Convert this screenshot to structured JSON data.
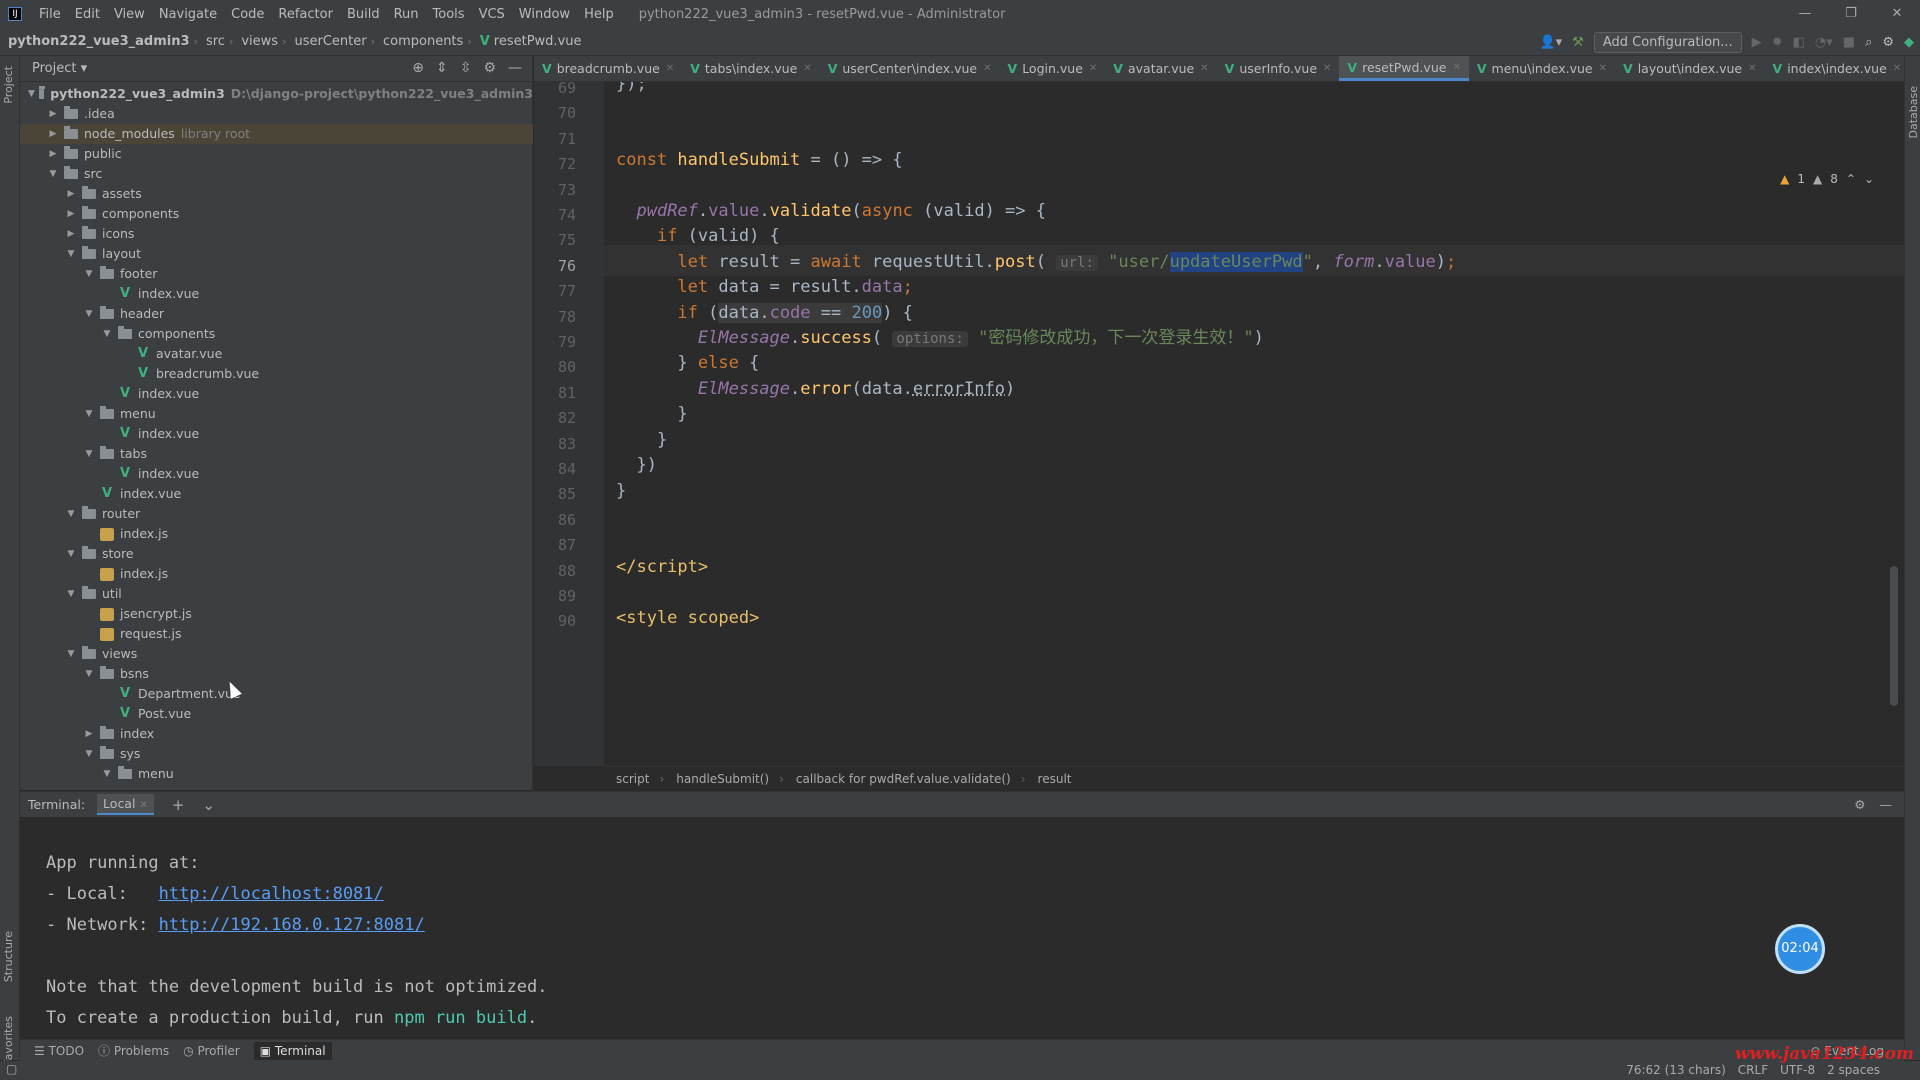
{
  "titlebar": {
    "menus": [
      "File",
      "Edit",
      "View",
      "Navigate",
      "Code",
      "Refactor",
      "Build",
      "Run",
      "Tools",
      "VCS",
      "Window",
      "Help"
    ],
    "title": "python222_vue3_admin3 - resetPwd.vue - Administrator"
  },
  "navbar": {
    "crumbs": [
      "python222_vue3_admin3",
      "src",
      "views",
      "userCenter",
      "components",
      "resetPwd.vue"
    ],
    "add_config": "Add Configuration..."
  },
  "project": {
    "label": "Project",
    "tree": [
      {
        "indent": 0,
        "type": "root",
        "open": true,
        "name": "python222_vue3_admin3",
        "hint": "D:\\django-project\\python222_vue3_admin3"
      },
      {
        "indent": 1,
        "type": "folder",
        "open": false,
        "name": ".idea"
      },
      {
        "indent": 1,
        "type": "folder",
        "open": false,
        "name": "node_modules",
        "hint": "library root",
        "selected": true
      },
      {
        "indent": 1,
        "type": "folder",
        "open": false,
        "name": "public"
      },
      {
        "indent": 1,
        "type": "folder",
        "open": true,
        "name": "src"
      },
      {
        "indent": 2,
        "type": "folder",
        "open": false,
        "name": "assets"
      },
      {
        "indent": 2,
        "type": "folder",
        "open": false,
        "name": "components"
      },
      {
        "indent": 2,
        "type": "folder",
        "open": false,
        "name": "icons"
      },
      {
        "indent": 2,
        "type": "folder",
        "open": true,
        "name": "layout"
      },
      {
        "indent": 3,
        "type": "folder",
        "open": true,
        "name": "footer"
      },
      {
        "indent": 4,
        "type": "vue",
        "name": "index.vue"
      },
      {
        "indent": 3,
        "type": "folder",
        "open": true,
        "name": "header"
      },
      {
        "indent": 4,
        "type": "folder",
        "open": true,
        "name": "components"
      },
      {
        "indent": 5,
        "type": "vue",
        "name": "avatar.vue"
      },
      {
        "indent": 5,
        "type": "vue",
        "name": "breadcrumb.vue"
      },
      {
        "indent": 4,
        "type": "vue",
        "name": "index.vue"
      },
      {
        "indent": 3,
        "type": "folder",
        "open": true,
        "name": "menu"
      },
      {
        "indent": 4,
        "type": "vue",
        "name": "index.vue"
      },
      {
        "indent": 3,
        "type": "folder",
        "open": true,
        "name": "tabs"
      },
      {
        "indent": 4,
        "type": "vue",
        "name": "index.vue"
      },
      {
        "indent": 3,
        "type": "vue",
        "name": "index.vue"
      },
      {
        "indent": 2,
        "type": "folder",
        "open": true,
        "name": "router"
      },
      {
        "indent": 3,
        "type": "js",
        "name": "index.js"
      },
      {
        "indent": 2,
        "type": "folder",
        "open": true,
        "name": "store"
      },
      {
        "indent": 3,
        "type": "js",
        "name": "index.js"
      },
      {
        "indent": 2,
        "type": "folder",
        "open": true,
        "name": "util"
      },
      {
        "indent": 3,
        "type": "js",
        "name": "jsencrypt.js"
      },
      {
        "indent": 3,
        "type": "js",
        "name": "request.js"
      },
      {
        "indent": 2,
        "type": "folder",
        "open": true,
        "name": "views"
      },
      {
        "indent": 3,
        "type": "folder",
        "open": true,
        "name": "bsns"
      },
      {
        "indent": 4,
        "type": "vue",
        "name": "Department.vue"
      },
      {
        "indent": 4,
        "type": "vue",
        "name": "Post.vue"
      },
      {
        "indent": 3,
        "type": "folder",
        "open": false,
        "name": "index"
      },
      {
        "indent": 3,
        "type": "folder",
        "open": true,
        "name": "sys"
      },
      {
        "indent": 4,
        "type": "folder",
        "open": true,
        "name": "menu"
      }
    ]
  },
  "tabs": [
    {
      "label": "breadcrumb.vue"
    },
    {
      "label": "tabs\\index.vue"
    },
    {
      "label": "userCenter\\index.vue"
    },
    {
      "label": "Login.vue"
    },
    {
      "label": "avatar.vue"
    },
    {
      "label": "userInfo.vue"
    },
    {
      "label": "resetPwd.vue",
      "active": true
    },
    {
      "label": "menu\\index.vue"
    },
    {
      "label": "layout\\index.vue"
    },
    {
      "label": "index\\index.vue"
    }
  ],
  "editor": {
    "line_numbers": [
      "69",
      "70",
      "71",
      "72",
      "73",
      "74",
      "75",
      "76",
      "77",
      "78",
      "79",
      "80",
      "81",
      "82",
      "83",
      "84",
      "85",
      "86",
      "87",
      "88",
      "89",
      "90"
    ],
    "current_line": "76",
    "warnings": {
      "warn_count": "1",
      "weak_count": "8"
    },
    "hint_url": "url:",
    "hint_options": "options:",
    "str_url_prefix": "\"user/",
    "str_url_selected": "updateUserPwd",
    "str_url_suffix": "\"",
    "msg_success": "\"密码修改成功，下一次登录生效！\"",
    "breadcrumb": [
      "script",
      "handleSubmit()",
      "callback for pwdRef.value.validate()",
      "result"
    ]
  },
  "terminal": {
    "label": "Terminal:",
    "tab": "Local",
    "lines": {
      "running": "App running at:",
      "local_label": "- Local:   ",
      "local_url": "http://localhost:8081/",
      "network_label": "- Network: ",
      "network_url": "http://192.168.0.127:8081/",
      "note": "Note that the development build is not optimized.",
      "build_prefix": "To create a production build, run ",
      "build_cmd": "npm run build",
      "build_suffix": "."
    },
    "timer": "02:04"
  },
  "bottom_tools": [
    "TODO",
    "Problems",
    "Profiler",
    "Terminal"
  ],
  "status": {
    "position": "76:62 (13 chars)",
    "line_sep": "CRLF",
    "encoding": "UTF-8",
    "indent": "2 spaces",
    "event_log": "Event Log"
  },
  "side_labels": {
    "project": "Project",
    "structure": "Structure",
    "favorites": "Favorites",
    "database": "Database"
  },
  "watermark": "www.java1234.com"
}
